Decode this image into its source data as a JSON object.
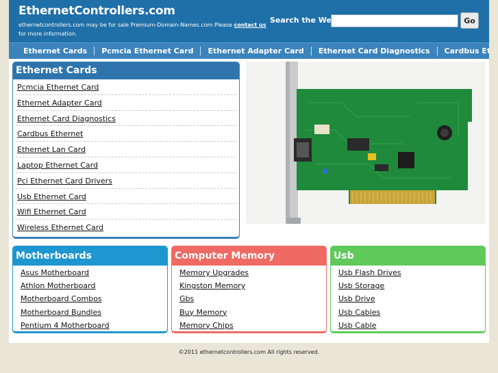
{
  "header": {
    "site_title": "EthernetControllers.com",
    "notice_text": "ethernetcontrollers.com may be for sale Premium-Domain-Names.com Please ",
    "notice_link": "contact us",
    "notice_tail": " for more information.",
    "search_label": "Search the Web:",
    "search_value": "",
    "search_button": "Go"
  },
  "nav": {
    "items": [
      "Ethernet Cards",
      "Pcmcia Ethernet Card",
      "Ethernet Adapter Card",
      "Ethernet Card Diagnostics",
      "Cardbus Ethernet"
    ]
  },
  "main_box": {
    "title": "Ethernet Cards",
    "links": [
      "Pcmcia Ethernet Card",
      "Ethernet Adapter Card",
      "Ethernet Card Diagnostics",
      "Cardbus Ethernet",
      "Ethernet Lan Card",
      "Laptop Ethernet Card",
      "Pci Ethernet Card Drivers",
      "Usb Ethernet Card",
      "Wifi Ethernet Card",
      "Wireless Ethernet Card"
    ]
  },
  "categories": [
    {
      "title": "Motherboards",
      "color": "#1e96cf",
      "links": [
        "Asus Motherboard",
        "Athlon Motherboard",
        "Motherboard Combos",
        "Motherboard Bundles",
        "Pentium 4 Motherboard"
      ]
    },
    {
      "title": "Computer Memory",
      "color": "#ee6a63",
      "links": [
        "Memory Upgrades",
        "Kingston Memory",
        "Gbs",
        "Buy Memory",
        "Memory Chips"
      ]
    },
    {
      "title": "Usb",
      "color": "#5fc95a",
      "links": [
        "Usb Flash Drives",
        "Usb Storage",
        "Usb Drive",
        "Usb Cables",
        "Usb Cable"
      ]
    }
  ],
  "footer": {
    "text": "©2011 ethernetcontrollers.com All rights reserved."
  }
}
